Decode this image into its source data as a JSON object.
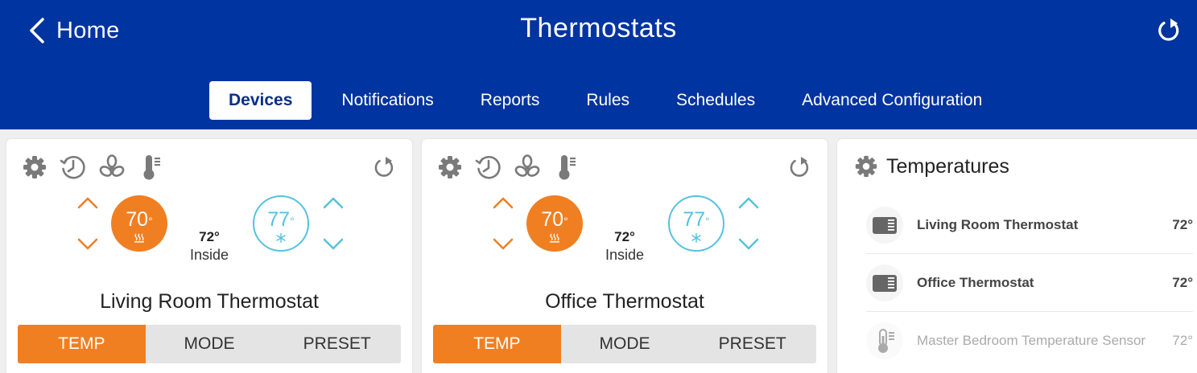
{
  "header": {
    "back_label": "Home",
    "title": "Thermostats",
    "background": "#0034a0"
  },
  "tabs": [
    {
      "label": "Devices",
      "active": true
    },
    {
      "label": "Notifications"
    },
    {
      "label": "Reports"
    },
    {
      "label": "Rules"
    },
    {
      "label": "Schedules"
    },
    {
      "label": "Advanced Configuration"
    }
  ],
  "thermostats": [
    {
      "name": "Living Room Thermostat",
      "heat_setpoint": "70",
      "cool_setpoint": "77",
      "inside_temp": "72°",
      "inside_label": "Inside",
      "modes": [
        "TEMP",
        "MODE",
        "PRESET"
      ],
      "selected_mode": "TEMP"
    },
    {
      "name": "Office Thermostat",
      "heat_setpoint": "70",
      "cool_setpoint": "77",
      "inside_temp": "72°",
      "inside_label": "Inside",
      "modes": [
        "TEMP",
        "MODE",
        "PRESET"
      ],
      "selected_mode": "TEMP"
    }
  ],
  "temperatures": {
    "title": "Temperatures",
    "items": [
      {
        "name": "Living Room Thermostat",
        "value": "72°",
        "icon": "thermostat-icon"
      },
      {
        "name": "Office Thermostat",
        "value": "72°",
        "icon": "thermostat-icon"
      },
      {
        "name": "Master Bedroom Temperature Sensor",
        "value": "72°",
        "icon": "thermometer-icon"
      }
    ]
  },
  "colors": {
    "heat": "#f07f22",
    "cool": "#55c2de",
    "accent": "#0034a0"
  },
  "degree_symbol": "°"
}
